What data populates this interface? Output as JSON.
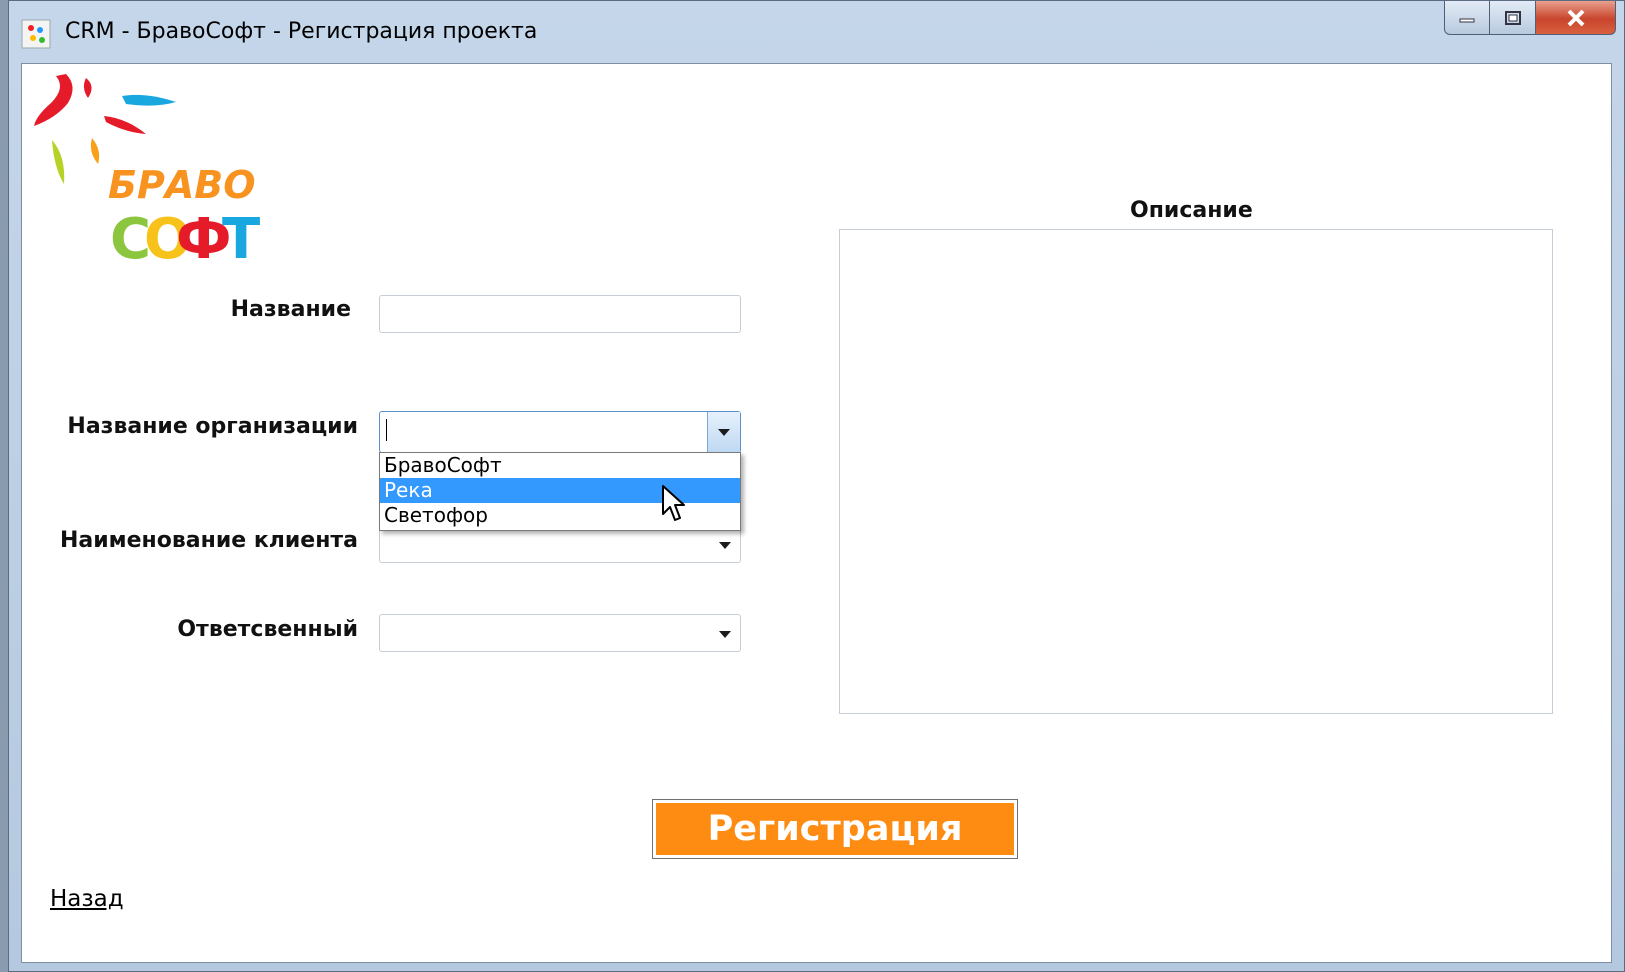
{
  "window": {
    "title": "CRM - БравоСофт - Регистрация проекта"
  },
  "form": {
    "name_label": "Название",
    "name_value": "",
    "org_label": "Название организации",
    "org_value": "",
    "org_options": [
      "БравоСофт",
      "Река",
      "Светофор"
    ],
    "org_selected_index": 1,
    "client_label": "Наименование клиента",
    "client_value": "",
    "responsible_label": "Ответсвенный",
    "responsible_value": ""
  },
  "description": {
    "title": "Описание",
    "value": ""
  },
  "actions": {
    "register_label": "Регистрация",
    "back_label": "Назад"
  },
  "colors": {
    "accent_orange": "#ff8c12",
    "selection_blue": "#3399ff"
  }
}
